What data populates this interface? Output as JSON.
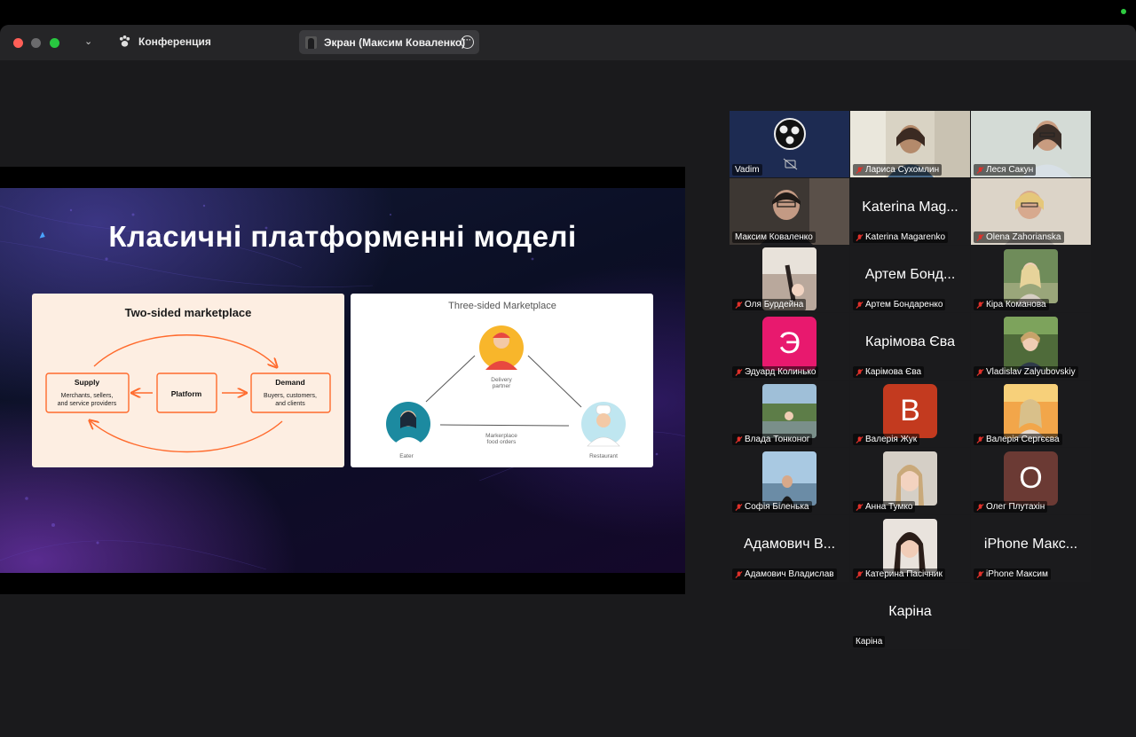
{
  "window": {
    "app_title": "Конференция",
    "share_label": "Экран (Максим Коваленко)"
  },
  "slide": {
    "title": "Класичні платформенні моделі",
    "two_sided": {
      "heading": "Two-sided marketplace",
      "supply_title": "Supply",
      "supply_lines": [
        "Merchants, sellers,",
        "and service providers"
      ],
      "platform": "Platform",
      "demand_title": "Demand",
      "demand_lines": [
        "Buyers, customers,",
        "and clients"
      ]
    },
    "three_sided": {
      "heading": "Three-sided Marketplace",
      "delivery_lines": [
        "Delivery",
        "partner"
      ],
      "eater": "Eater",
      "restaurant": "Restaurant",
      "orders_lines": [
        "Markerplace",
        "food orders"
      ]
    }
  },
  "participants": [
    {
      "name": "Vadim",
      "muted": false,
      "kind": "logo"
    },
    {
      "name": "Лариса Сухомлин",
      "muted": true,
      "kind": "video"
    },
    {
      "name": "Леся Сакун",
      "muted": true,
      "kind": "video"
    },
    {
      "name": "Максим Коваленко",
      "muted": false,
      "kind": "video",
      "active": true
    },
    {
      "name": "Katerina Magarenko",
      "muted": true,
      "kind": "text",
      "display": "Katerina Mag..."
    },
    {
      "name": "Olena Zahorianska",
      "muted": true,
      "kind": "video"
    },
    {
      "name": "Оля Бурдейна",
      "muted": true,
      "kind": "video"
    },
    {
      "name": "Артем Бондаренко",
      "muted": true,
      "kind": "text",
      "display": "Артем Бонд..."
    },
    {
      "name": "Кіра Команова",
      "muted": true,
      "kind": "photo"
    },
    {
      "name": "Эдуард Колинько",
      "muted": true,
      "kind": "letter",
      "letter": "Э",
      "color": "#e8196e"
    },
    {
      "name": "Карімова Єва",
      "muted": true,
      "kind": "text",
      "display": "Карімова Єва"
    },
    {
      "name": "Vladislav Zalyubovskiy",
      "muted": true,
      "kind": "photo"
    },
    {
      "name": "Влада Тонконог",
      "muted": true,
      "kind": "photo"
    },
    {
      "name": "Валерія Жук",
      "muted": true,
      "kind": "letter",
      "letter": "B",
      "color": "#c33a1f"
    },
    {
      "name": "Валерія Сергєєва",
      "muted": true,
      "kind": "photo"
    },
    {
      "name": "Софія Біленька",
      "muted": true,
      "kind": "photo"
    },
    {
      "name": "Анна Тумко",
      "muted": true,
      "kind": "photo"
    },
    {
      "name": "Олег Плутахін",
      "muted": true,
      "kind": "letter",
      "letter": "O",
      "color": "#6b3a34"
    },
    {
      "name": "Адамович Владислав",
      "muted": true,
      "kind": "text",
      "display": "Адамович В..."
    },
    {
      "name": "Катерина Пасічник",
      "muted": true,
      "kind": "photo"
    },
    {
      "name": "iPhone Максим",
      "muted": true,
      "kind": "text",
      "display": "iPhone Макс..."
    },
    {
      "name": "Каріна",
      "muted": false,
      "kind": "text",
      "display": "Каріна"
    }
  ],
  "colors": {
    "accent_orange": "#ff6a2c",
    "active_speaker": "#4cd964",
    "mute_red": "#e0312a"
  }
}
